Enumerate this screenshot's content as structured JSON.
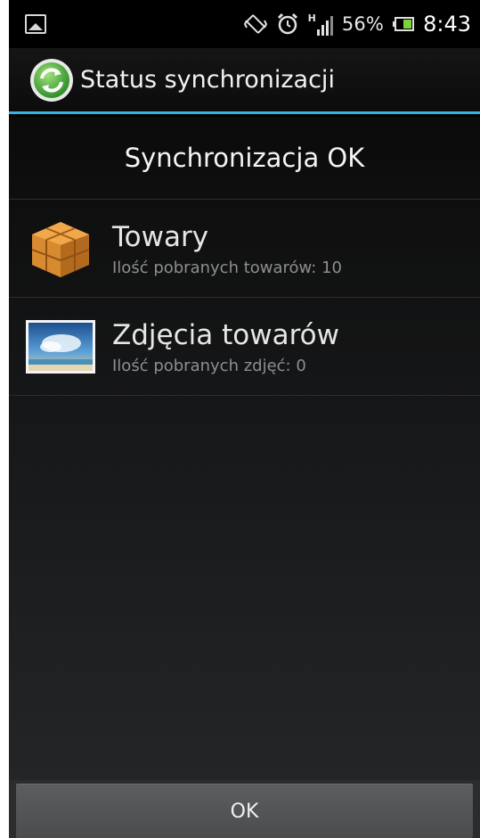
{
  "status_bar": {
    "battery_percent": "56%",
    "time": "8:43",
    "network_type": "H",
    "icons": [
      "gallery-notification-icon",
      "rotation-icon",
      "alarm-icon",
      "signal-icon",
      "battery-icon"
    ]
  },
  "action_bar": {
    "title": "Status synchronizacji",
    "app_icon": "sync-icon"
  },
  "sync_status": "Synchronizacja OK",
  "items": [
    {
      "title": "Towary",
      "subtitle": "Ilość pobranych towarów: 10",
      "icon": "boxes-icon"
    },
    {
      "title": "Zdjęcia towarów",
      "subtitle": "Ilość pobranych zdjęć: 0",
      "icon": "picture-icon"
    }
  ],
  "ok_button": "OK",
  "colors": {
    "accent": "#33b5e5",
    "background": "#000000",
    "button": "#55575a"
  }
}
